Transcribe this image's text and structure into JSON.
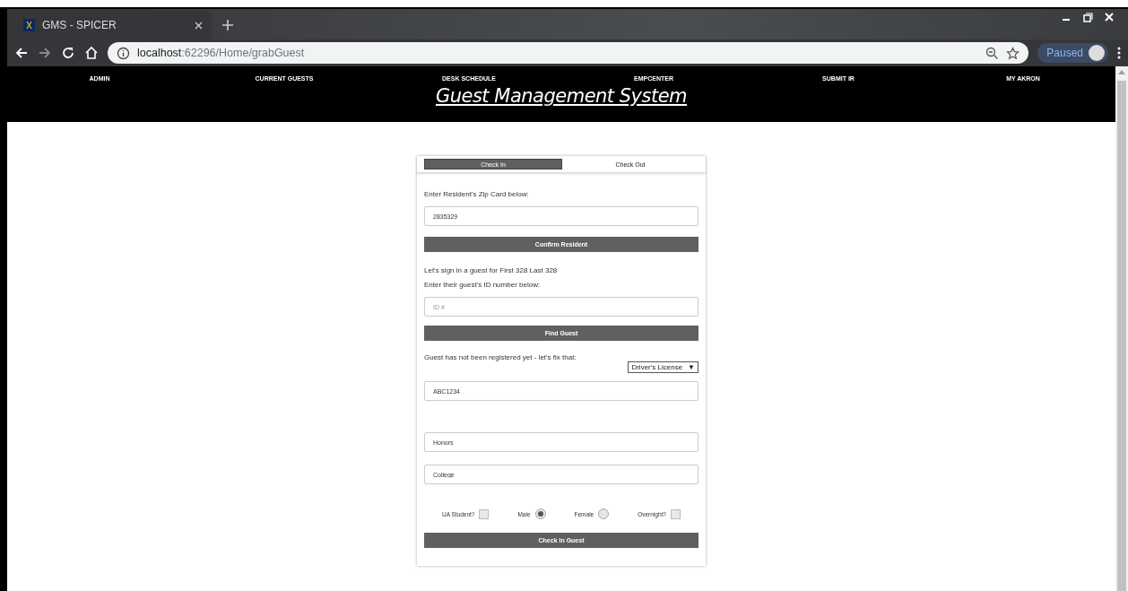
{
  "browser": {
    "tab_title": "GMS - SPICER",
    "url_host": "localhost",
    "url_path": ":62296/Home/grabGuest",
    "profile_status": "Paused"
  },
  "nav": {
    "items": [
      "ADMIN",
      "CURRENT GUESTS",
      "DESK SCHEDULE",
      "EMPCENTER",
      "SUBMIT IR",
      "MY AKRON"
    ],
    "title": "Guest Management System"
  },
  "tabs": [
    {
      "label": "Check In",
      "selected": true
    },
    {
      "label": "Check Out",
      "selected": false
    }
  ],
  "form": {
    "zip_label": "Enter Resident's Zip Card below:",
    "zip_value": "2835329",
    "confirm_button": "Confirm Resident",
    "guest_line": "Let's sign in a guest for First 328 Last 328",
    "id_label": "Enter their guest's ID number below:",
    "id_placeholder": "ID #",
    "find_button": "Find Guest",
    "not_registered": "Guest has not been registered yet - let's fix that:",
    "id_type": "Driver's License",
    "id_type_caret": "▼",
    "id_value": "ABC1234",
    "program_value": "Honors",
    "college_value": "College",
    "options": [
      {
        "kind": "checkbox",
        "label": "UA Student?",
        "checked": false
      },
      {
        "kind": "radio",
        "label": "Male",
        "selected": true
      },
      {
        "kind": "radio",
        "label": "Female",
        "selected": false
      },
      {
        "kind": "checkbox",
        "label": "Overnight?",
        "checked": false
      }
    ],
    "submit_button": "Check In Guest"
  }
}
